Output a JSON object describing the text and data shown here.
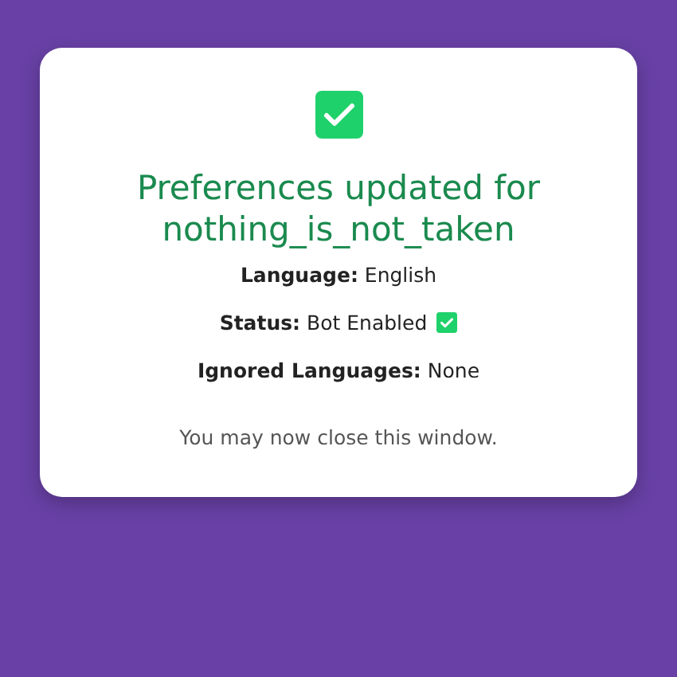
{
  "title": "Preferences updated for nothing_is_not_taken",
  "details": [
    {
      "text": "**Language:** English",
      "checked": false
    },
    {
      "text": "**Status:** Bot Enabled",
      "checked": true
    },
    {
      "text": "**Ignored Languages:** None",
      "checked": false
    }
  ],
  "footer": "You may now close this window."
}
